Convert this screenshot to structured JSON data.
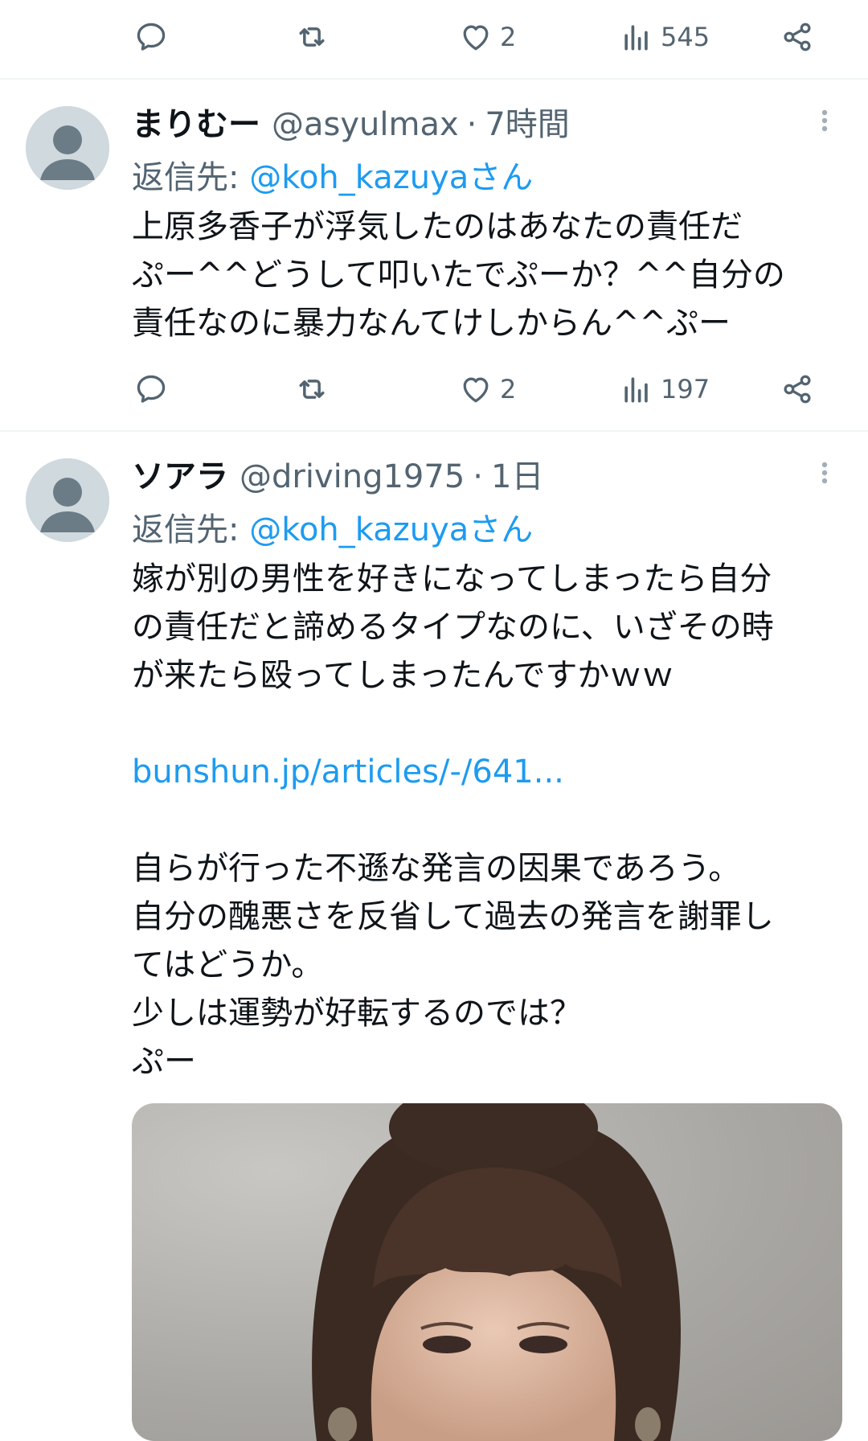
{
  "top_actions": {
    "likes": "2",
    "views": "545"
  },
  "tweets": [
    {
      "name": "まりむー",
      "handle": "@asyulmax",
      "sep": "·",
      "time": "7時間",
      "reply_prefix": "返信先:",
      "reply_to": "@koh_kazuyaさん",
      "lines": [
        "上原多香子が浮気したのはあなたの責任だ",
        "ぷー^^どうして叩いたでぷーか？^^自分の",
        "責任なのに暴力なんてけしからん^^ぷー"
      ],
      "likes": "2",
      "views": "197"
    },
    {
      "name": "ソアラ",
      "handle": "@driving1975",
      "sep": "·",
      "time": "1日",
      "reply_prefix": "返信先:",
      "reply_to": "@koh_kazuyaさん",
      "lines": [
        "嫁が別の男性を好きになってしまったら自分",
        "の責任だと諦めるタイプなのに、いざその時",
        "が来たら殴ってしまったんですかｗｗ"
      ],
      "link": "bunshun.jp/articles/-/641...",
      "lines2": [
        "自らが行った不遜な発言の因果であろう。",
        "自分の醜悪さを反省して過去の発言を謝罪し",
        "てはどうか。",
        "少しは運勢が好転するのでは？",
        "ぷー"
      ]
    }
  ],
  "colors": {
    "link": "#1d9bf0",
    "secondary": "#536471",
    "divider": "#eff3f4"
  }
}
